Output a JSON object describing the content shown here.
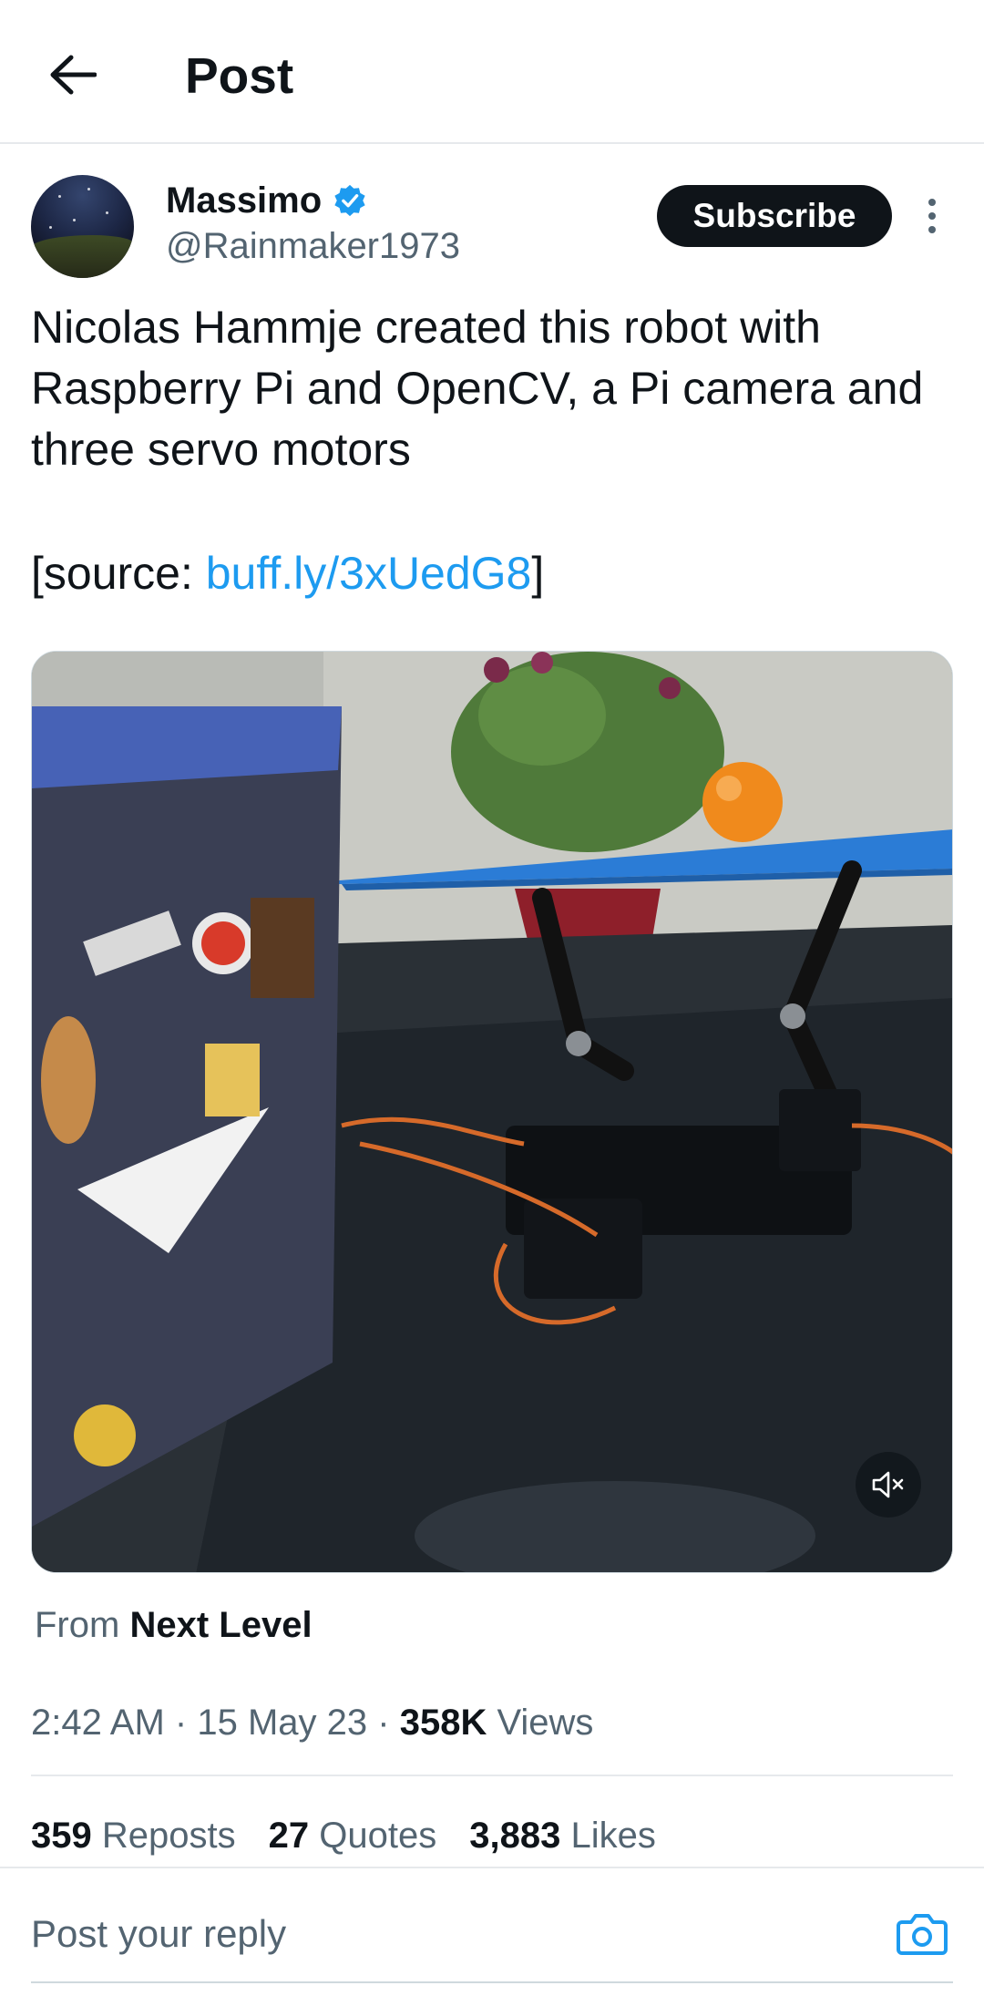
{
  "header": {
    "title": "Post",
    "back_icon": "arrow-left-icon"
  },
  "author": {
    "name": "Massimo",
    "handle": "@Rainmaker1973",
    "verified": true,
    "subscribe_label": "Subscribe"
  },
  "post": {
    "text": "Nicolas Hammje created this robot with Raspberry Pi and OpenCV, a Pi camera and three servo motors",
    "source_prefix": "[source: ",
    "source_link": "buff.ly/3xUedG8",
    "source_suffix": "]"
  },
  "media": {
    "type": "video",
    "mute_icon": "speaker-muted-icon"
  },
  "attribution": {
    "prefix": "From",
    "channel": "Next Level"
  },
  "meta": {
    "time": "2:42 AM",
    "separator": "·",
    "date": "15 May 23",
    "views_count": "358K",
    "views_label": "Views"
  },
  "stats": {
    "reposts_count": "359",
    "reposts_label": "Reposts",
    "quotes_count": "27",
    "quotes_label": "Quotes",
    "likes_count": "3,883",
    "likes_label": "Likes"
  },
  "reply": {
    "placeholder": "Post your reply",
    "camera_icon": "camera-icon"
  },
  "colors": {
    "accent": "#1d9bf0",
    "text": "#0f1419",
    "secondary": "#536471"
  }
}
